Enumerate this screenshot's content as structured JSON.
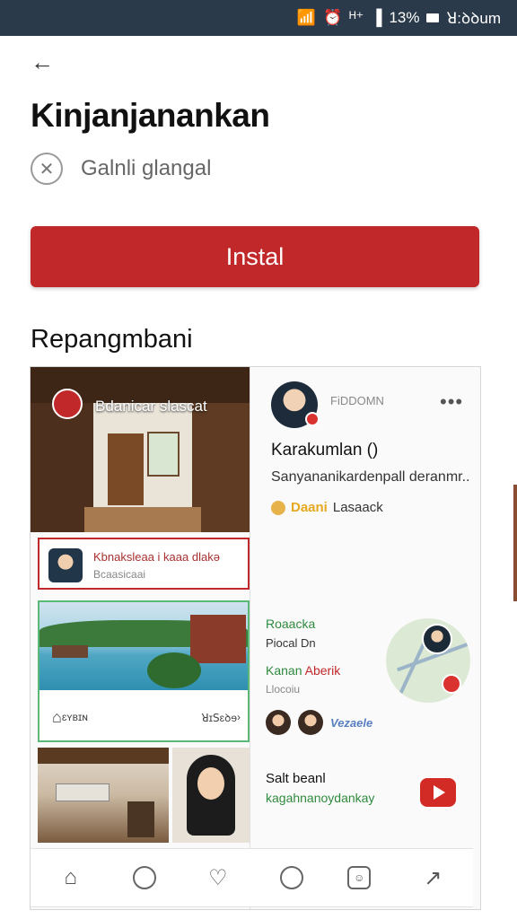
{
  "status_bar": {
    "battery_percent": "13%",
    "time": "ꓤ:ꝺꝺum",
    "signal_text": "ᴴ⁺"
  },
  "header": {
    "title": "Kinjanjanankan",
    "subtitle": "Galnli glangal"
  },
  "install": {
    "label": "Instal"
  },
  "section": {
    "title": "Repangmbani"
  },
  "preview": {
    "room_label": "Bdanicar slascat",
    "profile": {
      "handle": "FiDDOMN",
      "name": "Karakumlan ()",
      "description": "Sanyananikardenpall deranmr..",
      "follow_accent": "Daani",
      "follow_rest": "Lasaack"
    },
    "tag": {
      "title": "Kbnaksleaa i kaaa dlakə",
      "subtitle": "Bcaasicaai"
    },
    "lake_footer": {
      "left": "ɛʏʙɪɴ",
      "right": "ꓤɪꓢɛꝺɘ"
    },
    "map": {
      "title": "Roaacka",
      "subtitle": "Piocal Dn",
      "name_green": "Kanan",
      "name_red": "Aberik",
      "location": "Llocoiu"
    },
    "friends_label": "Vezaele",
    "video": {
      "title": "Salt beanl",
      "subtitle": "kagahnanoydankay"
    }
  },
  "colors": {
    "accent_red": "#c0282a",
    "status_bar": "#2b3a4a",
    "green": "#2f8a3e"
  }
}
